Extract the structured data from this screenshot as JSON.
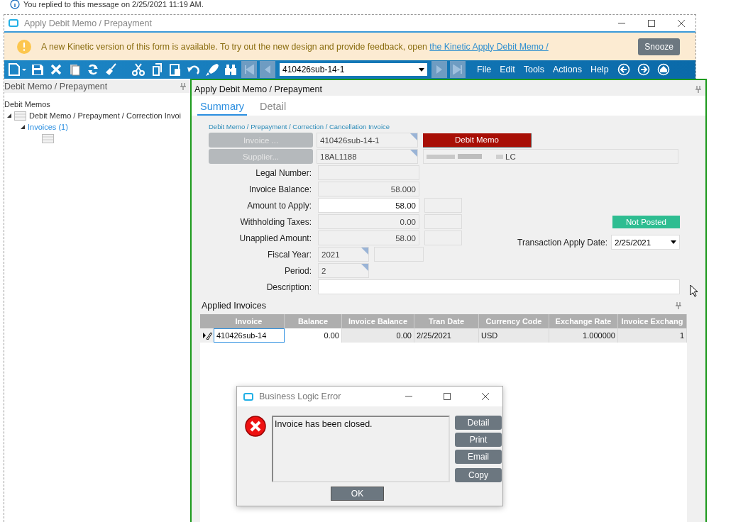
{
  "notice": "You replied to this message on 2/25/2021 11:19 AM.",
  "window": {
    "title": "Apply Debit Memo / Prepayment"
  },
  "banner": {
    "message": "A new Kinetic version of this form is available. To try out the new design and provide feedback, open ",
    "link": "the Kinetic Apply Debit Memo /",
    "button": "Snooze"
  },
  "toolbar": {
    "record": "410426sub-14-1",
    "menus": [
      "File",
      "Edit",
      "Tools",
      "Actions",
      "Help"
    ]
  },
  "tree_panel": {
    "title": "Debit Memo / Prepayment",
    "root": "Debit Memos",
    "items": [
      {
        "label": "Debit Memo / Prepayment  / Correction Invoi",
        "expanded": true,
        "children": [
          {
            "label": "Invoices (1)",
            "expanded": true,
            "children": [
              {
                "kind": "folder"
              }
            ]
          }
        ]
      }
    ]
  },
  "form_panel": {
    "title": "Apply Debit Memo / Prepayment",
    "tabs": [
      {
        "label": "Summary",
        "selected": true
      },
      {
        "label": "Detail",
        "selected": false
      }
    ],
    "section": "Debit Memo / Prepayment / Correction / Cancellation Invoice",
    "invoice_button": "Invoice ...",
    "invoice": "410426sub-14-1",
    "type_badge": "Debit Memo",
    "supplier_button": "Supplier...",
    "supplier_id": "18AL1188",
    "supplier_name": "LC",
    "rows": [
      {
        "kind": "plain",
        "label": "Legal Number:",
        "editable": false
      },
      {
        "kind": "amount",
        "label": "Invoice Balance:",
        "value": "58.000",
        "editable": false
      },
      {
        "kind": "amount_extra",
        "label": "Amount to Apply:",
        "value": "58.00",
        "editable": true
      },
      {
        "kind": "amount_extra",
        "label": "Withholding Taxes:",
        "value": "0.00",
        "editable": false
      },
      {
        "kind": "amount_extra",
        "label": "Unapplied Amount:",
        "value": "58.00",
        "editable": false
      },
      {
        "kind": "short_extra",
        "label": "Fiscal Year:",
        "value": "2021",
        "editable": false
      },
      {
        "kind": "short",
        "label": "Period:",
        "value": "2",
        "editable": false
      }
    ],
    "description": {
      "label": "Description:",
      "editable": true
    },
    "status_badge": "Not Posted",
    "apply_date": {
      "label": "Transaction Apply Date:",
      "value": "2/25/2021"
    }
  },
  "applied_invoices": {
    "title": "Applied Invoices",
    "columns": [
      "Invoice",
      "Balance",
      "Invoice Balance",
      "Tran Date",
      "Currency Code",
      "Exchange Rate",
      "Invoice Exchang"
    ],
    "rows": [
      {
        "editing": true,
        "cells": [
          "410426sub-14",
          "0.00",
          "0.00",
          "2/25/2021",
          "USD",
          "1.000000",
          "1"
        ]
      }
    ]
  },
  "dialog": {
    "title": "Business Logic Error",
    "message": "Invoice has been closed.",
    "buttons": [
      "Detail",
      "Print",
      "Email",
      "Copy"
    ],
    "ok": "OK"
  }
}
